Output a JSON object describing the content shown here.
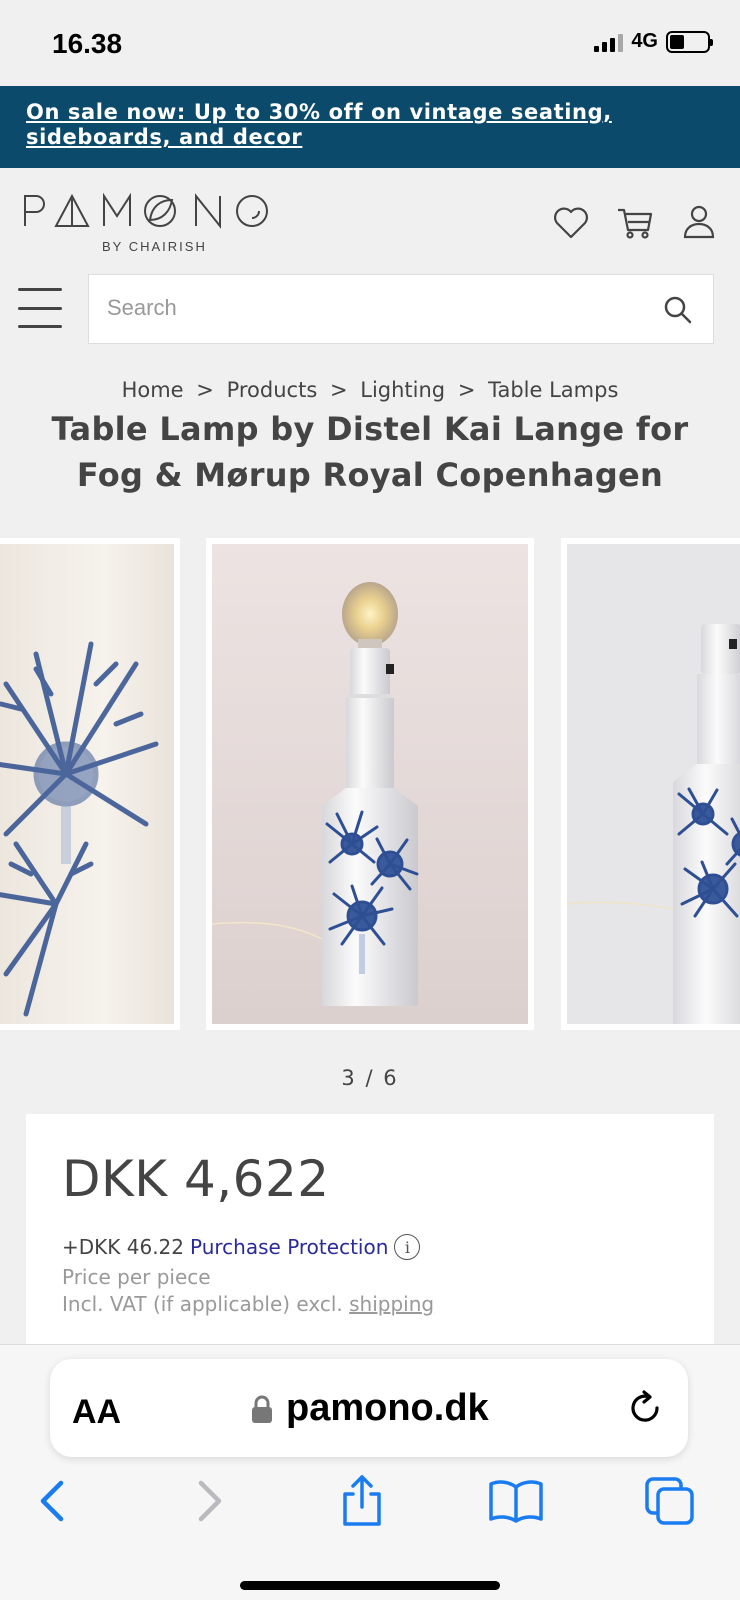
{
  "status": {
    "time": "16.38",
    "network": "4G"
  },
  "promo": {
    "text": "On sale now: Up to 30% off on vintage seating, sideboards, and decor"
  },
  "header": {
    "logo": "PAMONO",
    "logo_sub": "BY CHAIRISH"
  },
  "search": {
    "placeholder": "Search"
  },
  "breadcrumb": {
    "items": [
      "Home",
      "Products",
      "Lighting",
      "Table Lamps"
    ],
    "separator": ">"
  },
  "product": {
    "title": "Table Lamp by Distel Kai Lange for Fog & Mørup Royal Copenhagen",
    "pager": "3 / 6",
    "price": "DKK 4,622",
    "protection_price": "+DKK 46.22",
    "protection_label": "Purchase Protection",
    "per_piece": "Price per piece",
    "vat_text": "Incl. VAT (if applicable) excl.",
    "shipping_link": "shipping"
  },
  "browser": {
    "text_size": "AA",
    "url": "pamono.dk"
  },
  "colors": {
    "promo_bg": "#0b4a6b",
    "link_blue": "#2a2a9a",
    "safari_blue": "#1a7cf0"
  }
}
